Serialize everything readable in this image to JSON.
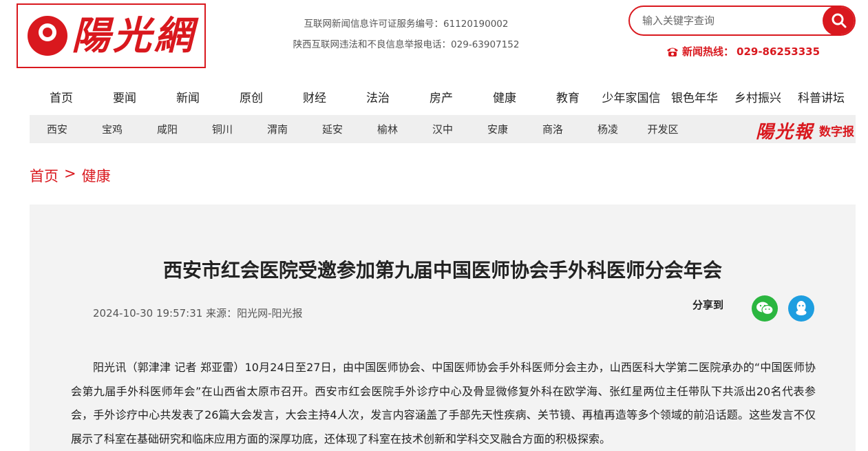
{
  "site": {
    "logo_text": "陽光網",
    "license_line1": "互联网新闻信息许可证服务编号：61120190002",
    "license_line2": "陕西互联网违法和不良信息举报电话：029-63907152",
    "search_placeholder": "输入关键字查询",
    "hotline_label": "新闻热线：",
    "hotline_number": "029-86253335"
  },
  "main_nav": [
    "首页",
    "要闻",
    "新闻",
    "原创",
    "财经",
    "法治",
    "房产",
    "健康",
    "教育",
    "少年家国信",
    "银色年华",
    "乡村振兴",
    "科普讲坛"
  ],
  "sub_nav": [
    "西安",
    "宝鸡",
    "咸阳",
    "铜川",
    "渭南",
    "延安",
    "榆林",
    "汉中",
    "安康",
    "商洛",
    "杨凌",
    "开发区"
  ],
  "epaper": {
    "logo": "陽光報",
    "label": "数字报"
  },
  "breadcrumb": {
    "home": "首页",
    "sep": ">",
    "current": "健康"
  },
  "article": {
    "title": "西安市红会医院受邀参加第九届中国医师协会手外科医师分会年会",
    "date": "2024-10-30 19:57:31",
    "source": "来源：阳光网-阳光报",
    "share_label": "分享到",
    "paragraph": "阳光讯（郭津津 记者 郑亚雷）10月24日至27日，由中国医师协会、中国医师协会手外科医师分会主办，山西医科大学第二医院承办的“中国医师协会第九届手外科医师年会”在山西省太原市召开。西安市红会医院手外诊疗中心及骨显微修复外科在欧学海、张红星两位主任带队下共派出20名代表参会，手外诊疗中心共发表了26篇大会发言，大会主持4人次，发言内容涵盖了手部先天性疾病、关节镜、再植再造等多个领域的前沿话题。这些发言不仅展示了科室在基础研究和临床应用方面的深厚功底，还体现了科室在技术创新和学科交叉融合方面的积极探索。"
  },
  "colors": {
    "brand_red": "#d9181e",
    "wechat_green": "#2bb640",
    "qq_blue": "#1e9ee0"
  },
  "icons": [
    "search-icon",
    "phone-icon",
    "wechat-icon",
    "qq-icon"
  ]
}
